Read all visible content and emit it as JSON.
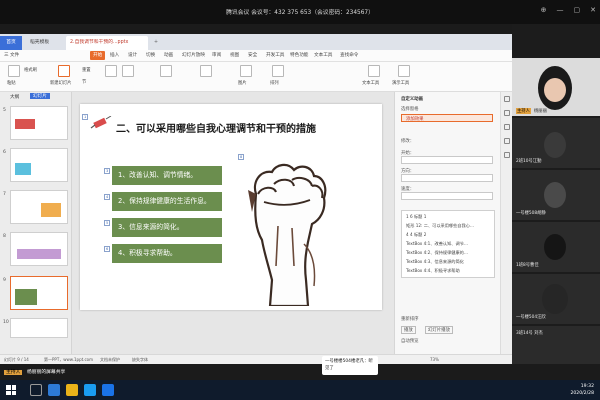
{
  "meeting": {
    "title": "腾讯会议 会议号：432 375 653（会议密码：234567）"
  },
  "wps": {
    "tabs": {
      "home": "首页",
      "templates": "稻壳模板",
      "doc": "2.自我调节和干预的...pptx",
      "plus": "+"
    },
    "menus": [
      "三 文件",
      "开始",
      "插入",
      "设计",
      "切换",
      "动画",
      "幻灯片放映",
      "审阅",
      "视图",
      "安全",
      "开发工具",
      "特色功能",
      "文本工具",
      "查找命令"
    ],
    "active_menu": "开始",
    "toolbar_labels": {
      "paste": "粘贴",
      "format_brush": "格式刷",
      "new_slide": "新建幻灯片",
      "reset": "重置",
      "section": "节",
      "arrange": "排列",
      "picture": "图片",
      "text_tool": "文本工具",
      "presentation_tool": "演示工具"
    },
    "side_panel": {
      "outline": "大纲",
      "slides": "幻灯片",
      "slide_numbers": [
        "5",
        "6",
        "7",
        "8",
        "9",
        "10"
      ]
    },
    "slide": {
      "title": "二、可以采用哪些自我心理调节和干预的措施",
      "items": [
        "1、改善认知、调节情绪。",
        "2、保持规律健康的生活作息。",
        "3、信息来源的简化。",
        "4、积极寻求帮助。"
      ],
      "marks": [
        "1",
        "2",
        "3",
        "4",
        "5",
        "6",
        "8"
      ]
    },
    "right_panel": {
      "header": "自定义动画",
      "select_pane": "选择窗格",
      "add_effect": "添加效果",
      "modify_label": "修改：",
      "start_label": "开始：",
      "direction_label": "方向：",
      "speed_label": "速度：",
      "list": [
        "1 6  标题 1",
        "   矩形 12: 二、可以采用哪些自我心…",
        "4 4  标题 2",
        "   TextBox 4:1、改善认知、调节…",
        "   TextBox 4:2、保持规律健康的…",
        "   TextBox 4:3、信息来源的简化",
        "   TextBox 4:4、积极寻求帮助"
      ],
      "reorder": "重新排序",
      "play": "播放",
      "slideshow": "幻灯片播放",
      "autopreview": "自动预览"
    },
    "status": {
      "slide_info": "幻灯片 9 / 14",
      "theme": "第一PPT，www.1ppt.com",
      "doc_protect": "文档未保护",
      "missing_font": "缺失字体",
      "zoom": "73%"
    }
  },
  "videos": [
    {
      "label": "主持人",
      "name": "杨丽丽"
    },
    {
      "label": "",
      "name": "2班10号江勤"
    },
    {
      "label": "",
      "name": "一号楼508胡静"
    },
    {
      "label": "",
      "name": "1班8号曹佳"
    },
    {
      "label": "",
      "name": "一号楼504汪欣"
    },
    {
      "label": "",
      "name": "3班14号 刘杰"
    }
  ],
  "bottom": {
    "host_tag": "主持人",
    "host_label": "杨丽丽的屏幕共享"
  },
  "chat": "一号楼楼504楼老凡：听见了",
  "taskbar": {
    "time": "19:32",
    "date": "2020/2/28"
  },
  "colors": {
    "accent": "#e86b2c",
    "box_green": "#6b8e4e",
    "wps_blue": "#3b6fd8"
  }
}
